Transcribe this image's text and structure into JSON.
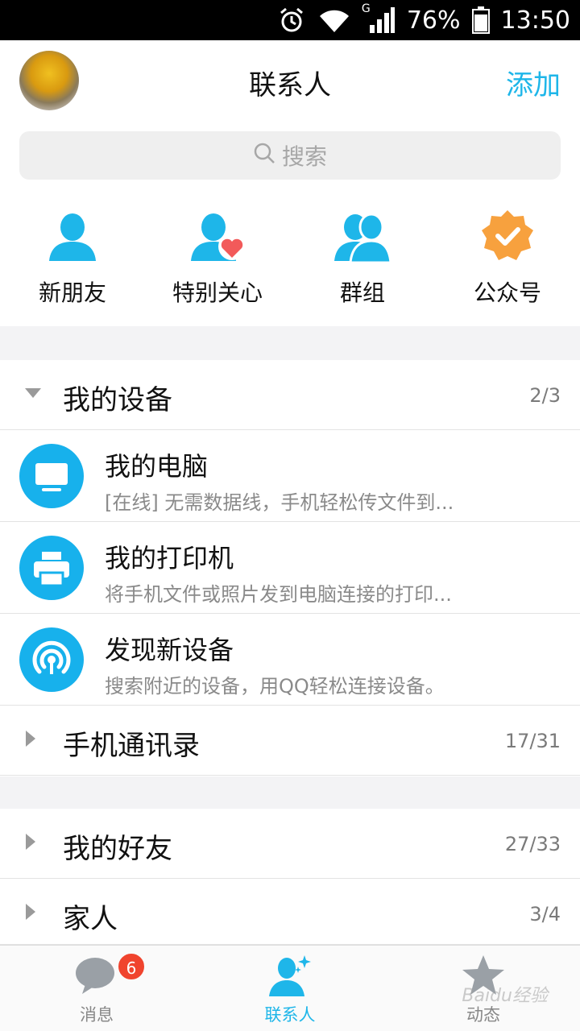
{
  "status_bar": {
    "battery": "76%",
    "time": "13:50",
    "network": "G"
  },
  "header": {
    "title": "联系人",
    "add_label": "添加"
  },
  "search": {
    "placeholder": "搜索"
  },
  "quick_items": [
    {
      "label": "新朋友",
      "icon": "person-icon"
    },
    {
      "label": "特别关心",
      "icon": "person-heart-icon"
    },
    {
      "label": "群组",
      "icon": "group-icon"
    },
    {
      "label": "公众号",
      "icon": "verified-badge-icon"
    }
  ],
  "sections": {
    "my_devices": {
      "label": "我的设备",
      "count": "2/3"
    },
    "devices": [
      {
        "title": "我的电脑",
        "subtitle": "[在线] 无需数据线，手机轻松传文件到...",
        "icon": "monitor-icon"
      },
      {
        "title": "我的打印机",
        "subtitle": "将手机文件或照片发到电脑连接的打印...",
        "icon": "printer-icon"
      },
      {
        "title": "发现新设备",
        "subtitle": "搜索附近的设备，用QQ轻松连接设备。",
        "icon": "radar-icon"
      }
    ],
    "phone_contacts": {
      "label": "手机通讯录",
      "count": "17/31"
    },
    "friends": {
      "label": "我的好友",
      "count": "27/33"
    },
    "family": {
      "label": "家人",
      "count": "3/4"
    }
  },
  "tabs": [
    {
      "label": "消息",
      "badge": "6"
    },
    {
      "label": "联系人"
    },
    {
      "label": "动态"
    }
  ],
  "watermark": "Baidu经验",
  "colors": {
    "accent": "#1eb6e9",
    "badge": "#f0442e",
    "official": "#f7a13e",
    "heart": "#f25a5a"
  }
}
